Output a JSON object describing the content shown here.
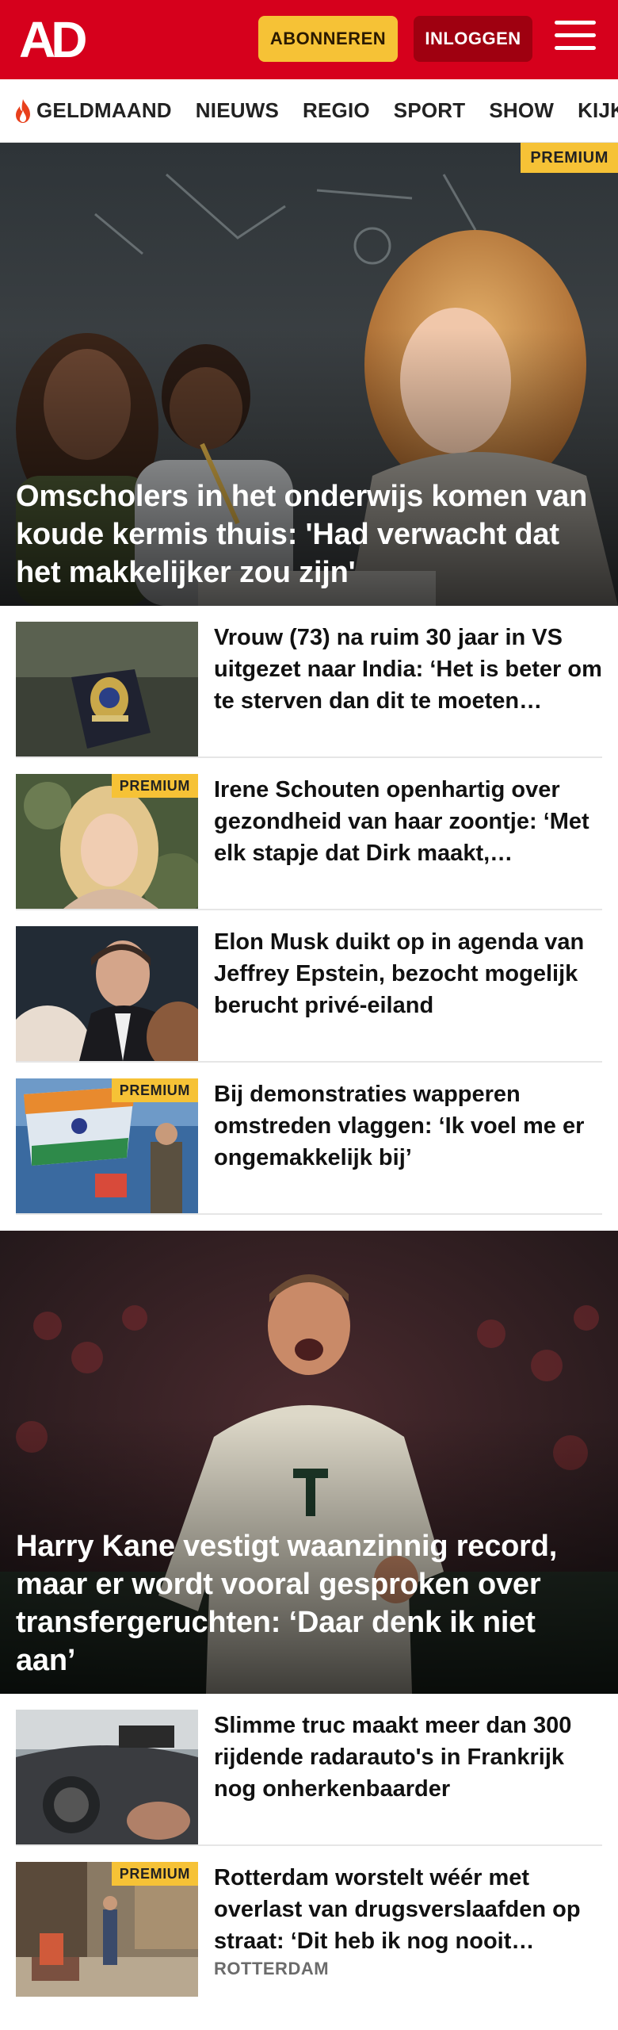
{
  "header": {
    "logo": "AD",
    "subscribe_label": "ABONNEREN",
    "login_label": "INLOGGEN"
  },
  "nav": {
    "items": [
      "GELDMAAND",
      "NIEUWS",
      "REGIO",
      "SPORT",
      "SHOW",
      "KIJK"
    ]
  },
  "badges": {
    "premium": "PREMIUM"
  },
  "hero1": {
    "title": "Omscholers in het onderwijs komen van koude kermis thuis: 'Had verwacht dat het makkelijker zou zijn'",
    "premium": true
  },
  "articles1": [
    {
      "title": "Vrouw (73) na ruim 30 jaar in VS uitgezet naar India: ‘Het is beter om te sterven dan dit te moeten…",
      "premium": false
    },
    {
      "title": "Irene Schouten openhartig over gezondheid van haar zoontje: ‘Met elk stapje dat Dirk maakt,…",
      "premium": true
    },
    {
      "title": "Elon Musk duikt op in agenda van Jeffrey Epstein, bezocht mogelijk berucht privé-eiland",
      "premium": false
    },
    {
      "title": "Bij demonstraties wapperen omstreden vlaggen: ‘Ik voel me er ongemakkelijk bij’",
      "premium": true
    }
  ],
  "hero2": {
    "title": "Harry Kane vestigt waanzinnig record, maar er wordt vooral gesproken over transfergeruchten: ‘Daar denk ik niet aan’"
  },
  "articles2": [
    {
      "title": "Slimme truc maakt meer dan 300 rijdende radarauto's in Frankrijk nog onherkenbaarder",
      "premium": false
    },
    {
      "title": "Rotterdam worstelt wéér met overlast van drugsverslaafden op straat: ‘Dit heb ik nog nooit…",
      "premium": true,
      "category": "ROTTERDAM"
    }
  ],
  "colors": {
    "brand_red": "#d6001c",
    "subscribe_yellow": "#f6c236",
    "login_dark_red": "#9f0010",
    "premium_yellow": "#f6c236"
  },
  "icons": [
    "flame-icon",
    "hamburger-menu-icon"
  ]
}
